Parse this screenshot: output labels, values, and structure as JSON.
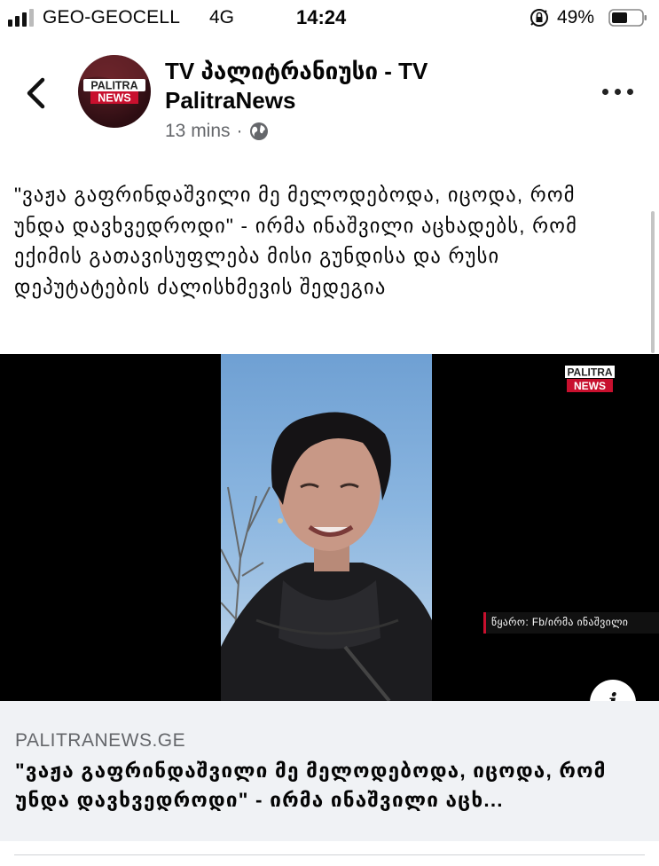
{
  "status_bar": {
    "carrier": "GEO-GEOCELL",
    "network": "4G",
    "time": "14:24",
    "battery": "49%",
    "signal_bars": 3
  },
  "post": {
    "page_name": "TV პალიტრანიუსი - TV PalitraNews",
    "time_ago": "13 mins",
    "separator": "·",
    "audience_icon": "globe-icon",
    "avatar": {
      "line1": "PALITRA",
      "line2": "NEWS"
    },
    "text": "\"ვაჟა გაფრინდაშვილი მე მელოდებოდა, იცოდა, რომ უნდა დავხვედროდი\" - ირმა ინაშვილი აცხადებს, რომ ექიმის გათავისუფლება მისი გუნდისა და რუსი დეპუტატების ძალისხმევის შედეგია"
  },
  "video": {
    "logo": {
      "line1": "PALITRA",
      "line2": "NEWS"
    },
    "source_caption": "წყარო: Fb/ირმა ინაშვილი",
    "info_label": "i"
  },
  "link_preview": {
    "domain": "PALITRANEWS.GE",
    "title": "\"ვაჟა გაფრინდაშვილი მე მელოდებოდა, იცოდა, რომ უნდა დავხვედროდი\" - ირმა ინაშვილი აცხ..."
  },
  "colors": {
    "brand_red": "#c8102e",
    "secondary_text": "#65676b",
    "preview_bg": "#f0f2f5"
  }
}
